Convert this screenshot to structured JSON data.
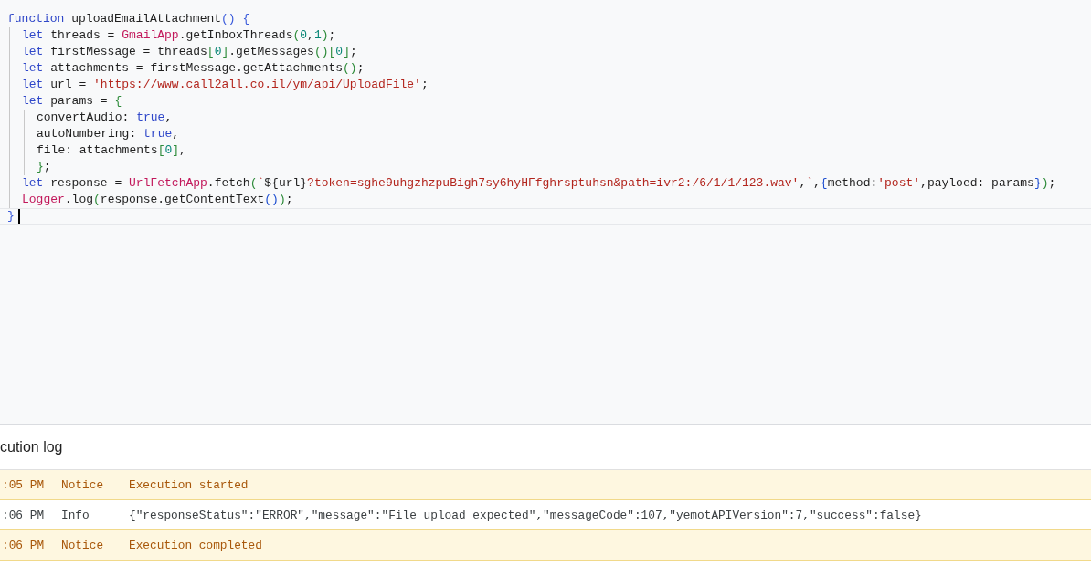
{
  "editor": {
    "lines": [
      {
        "current": false,
        "tokens": [
          {
            "kind": "keyword",
            "text": "function"
          },
          {
            "kind": "plain",
            "text": " uploadEmailAttachment"
          },
          {
            "kind": "bracket1",
            "text": "() {"
          }
        ],
        "children": [
          {
            "current": false,
            "tokens": [
              {
                "kind": "keyword",
                "text": "let"
              },
              {
                "kind": "plain",
                "text": " threads = "
              },
              {
                "kind": "class",
                "text": "GmailApp"
              },
              {
                "kind": "plain",
                "text": ".getInboxThreads"
              },
              {
                "kind": "bracket2",
                "text": "("
              },
              {
                "kind": "number",
                "text": "0"
              },
              {
                "kind": "plain",
                "text": ","
              },
              {
                "kind": "number",
                "text": "1"
              },
              {
                "kind": "bracket2",
                "text": ")"
              },
              {
                "kind": "plain",
                "text": ";"
              }
            ]
          },
          {
            "current": false,
            "tokens": [
              {
                "kind": "keyword",
                "text": "let"
              },
              {
                "kind": "plain",
                "text": " firstMessage = threads"
              },
              {
                "kind": "bracket2",
                "text": "["
              },
              {
                "kind": "number",
                "text": "0"
              },
              {
                "kind": "bracket2",
                "text": "]"
              },
              {
                "kind": "plain",
                "text": ".getMessages"
              },
              {
                "kind": "bracket2",
                "text": "()["
              },
              {
                "kind": "number",
                "text": "0"
              },
              {
                "kind": "bracket2",
                "text": "]"
              },
              {
                "kind": "plain",
                "text": ";"
              }
            ]
          },
          {
            "current": false,
            "tokens": [
              {
                "kind": "keyword",
                "text": "let"
              },
              {
                "kind": "plain",
                "text": " attachments = firstMessage.getAttachments"
              },
              {
                "kind": "bracket2",
                "text": "()"
              },
              {
                "kind": "plain",
                "text": ";"
              }
            ]
          },
          {
            "current": false,
            "tokens": [
              {
                "kind": "keyword",
                "text": "let"
              },
              {
                "kind": "plain",
                "text": " url = "
              },
              {
                "kind": "string",
                "text": "'"
              },
              {
                "kind": "link",
                "text": "https://www.call2all.co.il/ym/api/UploadFile"
              },
              {
                "kind": "string",
                "text": "'"
              },
              {
                "kind": "plain",
                "text": ";"
              }
            ]
          },
          {
            "current": false,
            "tokens": [
              {
                "kind": "keyword",
                "text": "let"
              },
              {
                "kind": "plain",
                "text": " params = "
              },
              {
                "kind": "bracket2",
                "text": "{"
              }
            ],
            "children": [
              {
                "current": false,
                "tokens": [
                  {
                    "kind": "plain",
                    "text": "convertAudio: "
                  },
                  {
                    "kind": "keyword",
                    "text": "true"
                  },
                  {
                    "kind": "plain",
                    "text": ","
                  }
                ]
              },
              {
                "current": false,
                "tokens": [
                  {
                    "kind": "plain",
                    "text": "autoNumbering: "
                  },
                  {
                    "kind": "keyword",
                    "text": "true"
                  },
                  {
                    "kind": "plain",
                    "text": ","
                  }
                ]
              },
              {
                "current": false,
                "tokens": [
                  {
                    "kind": "plain",
                    "text": "file: attachments"
                  },
                  {
                    "kind": "bracket2",
                    "text": "["
                  },
                  {
                    "kind": "number",
                    "text": "0"
                  },
                  {
                    "kind": "bracket2",
                    "text": "]"
                  },
                  {
                    "kind": "plain",
                    "text": ","
                  }
                ]
              },
              {
                "current": false,
                "tokens": [
                  {
                    "kind": "bracket2",
                    "text": "}"
                  },
                  {
                    "kind": "plain",
                    "text": ";"
                  }
                ]
              }
            ]
          },
          {
            "current": false,
            "tokens": [
              {
                "kind": "keyword",
                "text": "let"
              },
              {
                "kind": "plain",
                "text": " response = "
              },
              {
                "kind": "class",
                "text": "UrlFetchApp"
              },
              {
                "kind": "plain",
                "text": ".fetch"
              },
              {
                "kind": "bracket2",
                "text": "("
              },
              {
                "kind": "string",
                "text": "`"
              },
              {
                "kind": "plain",
                "text": "${url}"
              },
              {
                "kind": "string",
                "text": "?token=sghe9uhgzhzpuBigh7sy6hyHFfghrsptuhsn&path=ivr2:/6/1/1/123.wav'"
              },
              {
                "kind": "plain",
                "text": ","
              },
              {
                "kind": "string",
                "text": "`"
              },
              {
                "kind": "plain",
                "text": ","
              },
              {
                "kind": "bracket3",
                "text": "{"
              },
              {
                "kind": "plain",
                "text": "method:"
              },
              {
                "kind": "string",
                "text": "'post'"
              },
              {
                "kind": "plain",
                "text": ",payloed: params"
              },
              {
                "kind": "bracket3",
                "text": "}"
              },
              {
                "kind": "bracket2",
                "text": ")"
              },
              {
                "kind": "plain",
                "text": ";"
              }
            ]
          },
          {
            "current": false,
            "tokens": [
              {
                "kind": "class",
                "text": "Logger"
              },
              {
                "kind": "plain",
                "text": ".log"
              },
              {
                "kind": "bracket2",
                "text": "("
              },
              {
                "kind": "plain",
                "text": "response.getContentText"
              },
              {
                "kind": "bracket3",
                "text": "()"
              },
              {
                "kind": "bracket2",
                "text": ")"
              },
              {
                "kind": "plain",
                "text": ";"
              }
            ]
          }
        ]
      },
      {
        "current": true,
        "tokens": [
          {
            "kind": "bracket1",
            "text": "}"
          }
        ]
      }
    ]
  },
  "execution_log": {
    "title": "cution log",
    "rows": [
      {
        "kind": "notice",
        "time": ":05 PM",
        "level": "Notice",
        "message": "Execution started"
      },
      {
        "kind": "info",
        "time": ":06 PM",
        "level": "Info",
        "message": "{\"responseStatus\":\"ERROR\",\"message\":\"File upload expected\",\"messageCode\":107,\"yemotAPIVersion\":7,\"success\":false}"
      },
      {
        "kind": "notice",
        "time": ":06 PM",
        "level": "Notice",
        "message": "Execution completed"
      }
    ]
  }
}
